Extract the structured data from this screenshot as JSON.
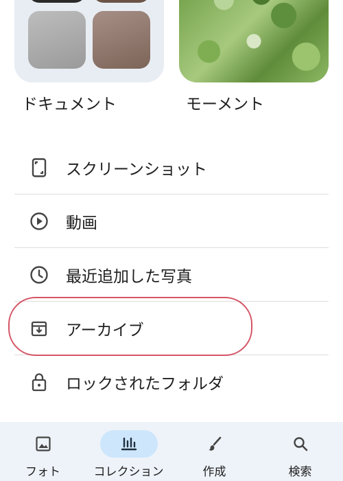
{
  "albums": [
    {
      "label": "ドキュメント"
    },
    {
      "label": "モーメント"
    }
  ],
  "list": [
    {
      "label": "スクリーンショット",
      "icon": "screenshot-icon"
    },
    {
      "label": "動画",
      "icon": "play-circle-icon"
    },
    {
      "label": "最近追加した写真",
      "icon": "clock-icon"
    },
    {
      "label": "アーカイブ",
      "icon": "archive-icon"
    },
    {
      "label": "ロックされたフォルダ",
      "icon": "lock-icon"
    }
  ],
  "nav": [
    {
      "label": "フォト",
      "icon": "photo-icon"
    },
    {
      "label": "コレクション",
      "icon": "collections-icon",
      "active": true
    },
    {
      "label": "作成",
      "icon": "brush-icon"
    },
    {
      "label": "検索",
      "icon": "search-icon"
    }
  ],
  "colors": {
    "highlight": "#d45566",
    "nav_background": "#eef3f9",
    "nav_active_pill": "#cde6fb"
  }
}
